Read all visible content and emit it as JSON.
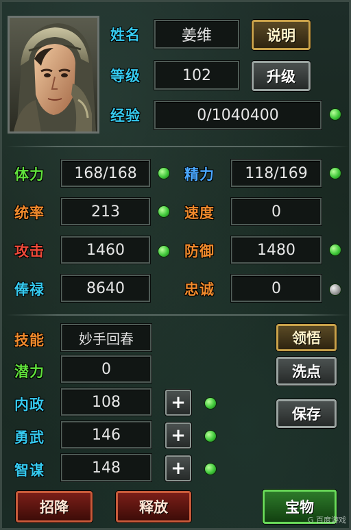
{
  "profile": {
    "name_label": "姓名",
    "name_value": "姜维",
    "info_button": "说明",
    "level_label": "等级",
    "level_value": "102",
    "levelup_button": "升级",
    "exp_label": "经验",
    "exp_value": "0/1040400"
  },
  "stats": {
    "stamina_label": "体力",
    "stamina_value": "168/168",
    "spirit_label": "精力",
    "spirit_value": "118/169",
    "command_label": "统率",
    "command_value": "213",
    "speed_label": "速度",
    "speed_value": "0",
    "attack_label": "攻击",
    "attack_value": "1460",
    "defense_label": "防御",
    "defense_value": "1480",
    "salary_label": "俸禄",
    "salary_value": "8640",
    "loyalty_label": "忠诚",
    "loyalty_value": "0"
  },
  "skills": {
    "skill_label": "技能",
    "skill_value": "妙手回春",
    "comprehend_button": "领悟",
    "potential_label": "潜力",
    "potential_value": "0",
    "reset_button": "洗点",
    "politics_label": "内政",
    "politics_value": "108",
    "valor_label": "勇武",
    "valor_value": "146",
    "wisdom_label": "智谋",
    "wisdom_value": "148",
    "save_button": "保存",
    "plus_symbol": "+"
  },
  "actions": {
    "recruit_button": "招降",
    "release_button": "释放",
    "treasure_button": "宝物"
  },
  "watermark": "G 百度游戏",
  "colors": {
    "label_cyan": "#35c9ee",
    "label_green": "#5fe03c",
    "label_orange": "#f08a2c",
    "label_red": "#ef4a3a",
    "label_blue": "#4aa8ff",
    "dot_green": "#3fc83a",
    "dot_grey": "#9a9a9a"
  },
  "icons": [
    "plus-icon",
    "green-dot-icon",
    "grey-dot-icon",
    "portrait-image"
  ]
}
